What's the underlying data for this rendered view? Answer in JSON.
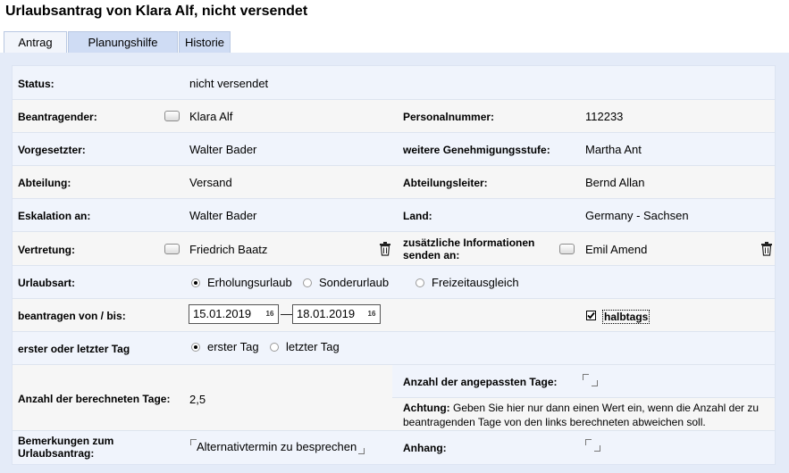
{
  "title": "Urlaubsantrag von Klara Alf, nicht versendet",
  "tabs": [
    {
      "label": "Antrag"
    },
    {
      "label": "Planungshilfe"
    },
    {
      "label": "Historie"
    }
  ],
  "form": {
    "status_label": "Status:",
    "status_value": "nicht versendet",
    "beantragender_label": "Beantragender:",
    "beantragender_value": "Klara Alf",
    "personalnummer_label": "Personalnummer:",
    "personalnummer_value": "112233",
    "vorgesetzter_label": "Vorgesetzter:",
    "vorgesetzter_value": "Walter Bader",
    "genehmigung_label": "weitere Genehmigungsstufe:",
    "genehmigung_value": "Martha Ant",
    "abteilung_label": "Abteilung:",
    "abteilung_value": "Versand",
    "abteilungsleiter_label": "Abteilungsleiter:",
    "abteilungsleiter_value": "Bernd Allan",
    "eskalation_label": "Eskalation an:",
    "eskalation_value": "Walter Bader",
    "land_label": "Land:",
    "land_value": "Germany - Sachsen",
    "vertretung_label": "Vertretung:",
    "vertretung_value": "Friedrich Baatz",
    "zusatz_label_line1": "zusätzliche Informationen",
    "zusatz_label_line2": "senden an:",
    "zusatz_value": "Emil Amend",
    "urlaubsart_label": "Urlaubsart:",
    "urlaubsart_options": [
      "Erholungsurlaub",
      "Sonderurlaub",
      "Freizeitausgleich"
    ],
    "urlaubsart_selected": "Erholungsurlaub",
    "von_bis_label": "beantragen von / bis:",
    "von_value": "15.01.2019",
    "bis_value": "18.01.2019",
    "calendar_icon_text": "16",
    "date_separator": "—",
    "halbtags_label": "halbtags",
    "halbtags_checked": true,
    "tag_label": "erster oder letzter Tag",
    "tag_options": [
      "erster Tag",
      "letzter Tag"
    ],
    "tag_selected": "erster Tag",
    "berechnete_label": "Anzahl der berechneten Tage:",
    "berechnete_value": "2,5",
    "angepasste_label": "Anzahl der angepassten Tage:",
    "angepasste_value": "",
    "achtung_label": "Achtung:",
    "achtung_text_line1": " Geben Sie hier nur dann einen Wert ein, wenn die Anzahl der zu",
    "achtung_text_line2": "beantragenden Tage von den links berechneten abweichen soll.",
    "bemerkungen_label_line1": "Bemerkungen zum",
    "bemerkungen_label_line2": "Urlaubsantrag:",
    "bemerkungen_value": "Alternativtermin zu besprechen",
    "anhang_label": "Anhang:",
    "anhang_value": ""
  },
  "colors": {
    "panel_bg": "#e4ebf8",
    "row_blue": "#f0f4fc",
    "row_grey": "#f6f6f6",
    "tab_inactive": "#cfdcf4"
  }
}
